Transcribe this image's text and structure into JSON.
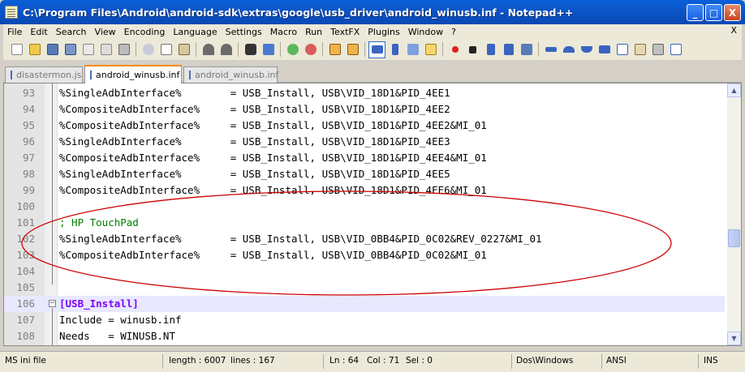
{
  "window": {
    "title": "C:\\Program Files\\Android\\android-sdk\\extras\\google\\usb_driver\\android_winusb.inf - Notepad++",
    "minimize_glyph": "_",
    "maximize_glyph": "□",
    "close_glyph": "X"
  },
  "menu": {
    "items": [
      "File",
      "Edit",
      "Search",
      "View",
      "Encoding",
      "Language",
      "Settings",
      "Macro",
      "Run",
      "TextFX",
      "Plugins",
      "Window",
      "?"
    ],
    "close_glyph": "X"
  },
  "toolbar": {
    "icons": [
      "new-file-icon",
      "open-file-icon",
      "save-icon",
      "save-all-icon",
      "close-icon",
      "close-all-icon",
      "print-icon",
      "cut-icon",
      "copy-icon",
      "paste-icon",
      "undo-icon",
      "redo-icon",
      "find-icon",
      "replace-icon",
      "zoom-in-icon",
      "zoom-out-icon",
      "sync-vertical-icon",
      "sync-horizontal-icon",
      "word-wrap-icon",
      "show-all-chars-icon",
      "indent-guide-icon",
      "user-lang-icon",
      "record-macro-icon",
      "stop-record-icon",
      "play-macro-icon",
      "run-macro-multiple-icon",
      "save-macro-icon"
    ]
  },
  "tabs": [
    {
      "label": "disastermon.js",
      "active": false
    },
    {
      "label": "android_winusb.inf",
      "active": true
    },
    {
      "label": "android_winusb.inf",
      "active": false
    }
  ],
  "editor": {
    "lines": [
      {
        "n": "93",
        "text": "%SingleAdbInterface%        = USB_Install, USB\\VID_18D1&PID_4EE1",
        "kind": "plain"
      },
      {
        "n": "94",
        "text": "%CompositeAdbInterface%     = USB_Install, USB\\VID_18D1&PID_4EE2",
        "kind": "plain"
      },
      {
        "n": "95",
        "text": "%CompositeAdbInterface%     = USB_Install, USB\\VID_18D1&PID_4EE2&MI_01",
        "kind": "plain"
      },
      {
        "n": "96",
        "text": "%SingleAdbInterface%        = USB_Install, USB\\VID_18D1&PID_4EE3",
        "kind": "plain"
      },
      {
        "n": "97",
        "text": "%CompositeAdbInterface%     = USB_Install, USB\\VID_18D1&PID_4EE4&MI_01",
        "kind": "plain"
      },
      {
        "n": "98",
        "text": "%SingleAdbInterface%        = USB_Install, USB\\VID_18D1&PID_4EE5",
        "kind": "plain"
      },
      {
        "n": "99",
        "text": "%CompositeAdbInterface%     = USB_Install, USB\\VID_18D1&PID_4EE6&MI_01",
        "kind": "plain"
      },
      {
        "n": "100",
        "text": "",
        "kind": "plain"
      },
      {
        "n": "101",
        "text": "; HP TouchPad",
        "kind": "comment"
      },
      {
        "n": "102",
        "text": "%SingleAdbInterface%        = USB_Install, USB\\VID_0BB4&PID_0C02&REV_0227&MI_01",
        "kind": "plain"
      },
      {
        "n": "103",
        "text": "%CompositeAdbInterface%     = USB_Install, USB\\VID_0BB4&PID_0C02&MI_01",
        "kind": "plain"
      },
      {
        "n": "104",
        "text": "",
        "kind": "plain"
      },
      {
        "n": "105",
        "text": "",
        "kind": "plain"
      },
      {
        "n": "106",
        "text": "[USB_Install]",
        "kind": "section"
      },
      {
        "n": "107",
        "text": "Include = winusb.inf",
        "kind": "plain"
      },
      {
        "n": "108",
        "text": "Needs   = WINUSB.NT",
        "kind": "plain"
      }
    ],
    "current_line": "106",
    "fold_glyph": "−"
  },
  "colors": {
    "comment": "#008000",
    "section": "#8000ff",
    "annotation": "#cc0000",
    "active_tab_accent": "#fa8a0a"
  },
  "status": {
    "file_type": "MS ini file",
    "length": "length : 6007",
    "lines": "lines : 167",
    "ln": "Ln : 64",
    "col": "Col : 71",
    "sel": "Sel : 0",
    "eol": "Dos\\Windows",
    "encoding": "ANSI",
    "mode": "INS"
  }
}
